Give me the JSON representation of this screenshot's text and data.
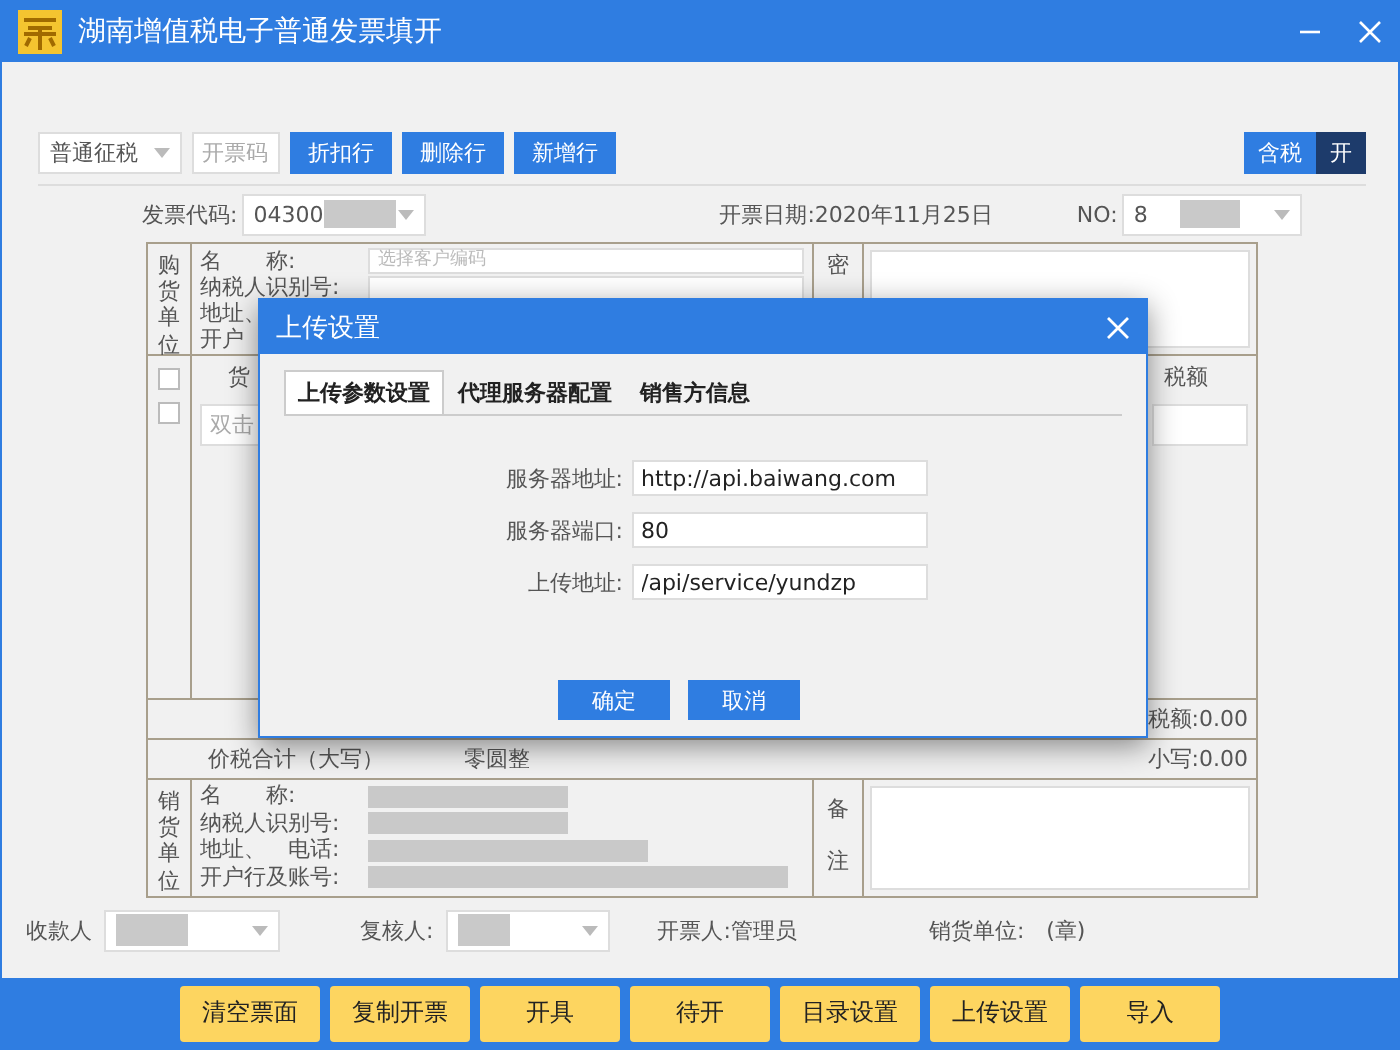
{
  "window": {
    "title": "湖南增值税电子普通发票填开"
  },
  "toolbar": {
    "tax_mode": "普通征税",
    "code_placeholder": "开票码",
    "buttons": [
      "折扣行",
      "删除行",
      "新增行"
    ],
    "tax_toggle": {
      "label": "含税",
      "state": "开",
      "on": true
    }
  },
  "invoice_header": {
    "code_label": "发票代码:",
    "code_value": "04300",
    "date": "开票日期:2020年11月25日",
    "no_label": "NO:",
    "no_value": "8"
  },
  "buyer": {
    "side_label": "购货单位",
    "fields": [
      {
        "label": "名　　称:",
        "placeholder": "选择客户编码"
      },
      {
        "label": "纳税人识别号:"
      },
      {
        "label": "地址、"
      },
      {
        "label": "开户"
      }
    ],
    "cipher_label": "密"
  },
  "goods": {
    "columns": [
      "货",
      "税额"
    ],
    "header_checked": false,
    "rows": [
      {
        "checked": false,
        "placeholder": "双击"
      }
    ]
  },
  "totals": {
    "tax": "税额:0.00",
    "words_label": "价税合计（大写）",
    "words": "零圆整",
    "small": "小写:0.00"
  },
  "seller": {
    "side_label": "销货单位",
    "fields": [
      "名　　称:",
      "纳税人识别号:",
      "地址、　电话:",
      "开户行及账号:"
    ],
    "remark_label": "备注"
  },
  "signatures": {
    "payee": "收款人",
    "reviewer": "复核人:",
    "drawer": "开票人:管理员",
    "stamp": "销货单位:　(章)"
  },
  "dialog": {
    "title": "上传设置",
    "tabs": [
      {
        "label": "上传参数设置",
        "selected": true
      },
      {
        "label": "代理服务器配置",
        "selected": false
      },
      {
        "label": "销售方信息",
        "selected": false
      }
    ],
    "fields": [
      {
        "label": "服务器地址:",
        "value": "http://api.baiwang.com"
      },
      {
        "label": "服务器端口:",
        "value": "80"
      },
      {
        "label": "上传地址:",
        "value": "/api/service/yundzp"
      }
    ],
    "buttons": [
      "确定",
      "取消"
    ]
  },
  "bottom_buttons": [
    "清空票面",
    "复制开票",
    "开具",
    "待开",
    "目录设置",
    "上传设置",
    "导入"
  ]
}
